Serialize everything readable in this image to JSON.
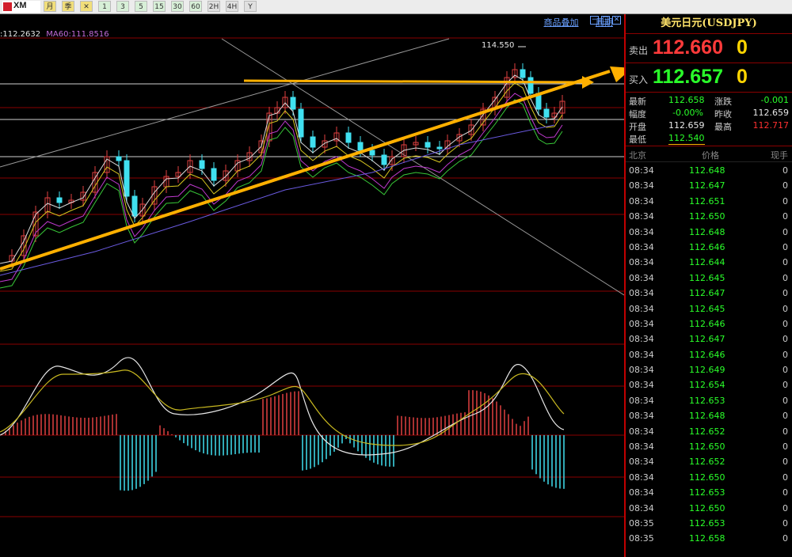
{
  "toolbar": {
    "logo_text": "XM",
    "buttons": [
      "月",
      "季",
      "✕",
      "1",
      "3",
      "5",
      "15",
      "30",
      "60",
      "2H",
      "4H",
      "Y"
    ]
  },
  "chart": {
    "ma_legend": [
      ":112.2632",
      "MA60:111.8516"
    ],
    "links": [
      "商品叠加",
      "周期"
    ],
    "window_buttons": [
      "−",
      "□",
      "✕"
    ],
    "peak_label": "114.550",
    "colors": {
      "bull": "#e04040",
      "bear": "#40e0f0",
      "grid": "#8a0000",
      "trend": "#ffb000"
    }
  },
  "side": {
    "title": "美元日元(USDJPY)",
    "sell_label": "卖出",
    "sell_value": "112.660",
    "sell_volume": "0",
    "buy_label": "买入",
    "buy_value": "112.657",
    "buy_volume": "0",
    "stats": [
      {
        "l1": "最新",
        "v1": "112.658",
        "c1": "#2aff2a",
        "l2": "涨跌",
        "v2": "-0.001",
        "c2": "#2aff2a"
      },
      {
        "l1": "幅度",
        "v1": "-0.00%",
        "c1": "#2aff2a",
        "l2": "昨收",
        "v2": "112.659",
        "c2": "#e6e6e6"
      },
      {
        "l1": "开盘",
        "v1": "112.659",
        "c1": "#e6e6e6",
        "l2": "最高",
        "v2": "112.717",
        "c2": "#ff3030"
      },
      {
        "l1": "最低",
        "v1": "112.540",
        "c1": "#2aff2a",
        "l2": "",
        "v2": "",
        "c2": "#e6e6e6"
      }
    ],
    "tick_header": {
      "time": "北京",
      "price": "价格",
      "vol": "现手"
    },
    "ticks": [
      {
        "time": "08:34",
        "price": "112.648",
        "vol": "0"
      },
      {
        "time": "08:34",
        "price": "112.647",
        "vol": "0"
      },
      {
        "time": "08:34",
        "price": "112.651",
        "vol": "0"
      },
      {
        "time": "08:34",
        "price": "112.650",
        "vol": "0"
      },
      {
        "time": "08:34",
        "price": "112.648",
        "vol": "0"
      },
      {
        "time": "08:34",
        "price": "112.646",
        "vol": "0"
      },
      {
        "time": "08:34",
        "price": "112.644",
        "vol": "0"
      },
      {
        "time": "08:34",
        "price": "112.645",
        "vol": "0"
      },
      {
        "time": "08:34",
        "price": "112.647",
        "vol": "0"
      },
      {
        "time": "08:34",
        "price": "112.645",
        "vol": "0"
      },
      {
        "time": "08:34",
        "price": "112.646",
        "vol": "0"
      },
      {
        "time": "08:34",
        "price": "112.647",
        "vol": "0"
      },
      {
        "time": "08:34",
        "price": "112.646",
        "vol": "0"
      },
      {
        "time": "08:34",
        "price": "112.649",
        "vol": "0"
      },
      {
        "time": "08:34",
        "price": "112.654",
        "vol": "0"
      },
      {
        "time": "08:34",
        "price": "112.653",
        "vol": "0"
      },
      {
        "time": "08:34",
        "price": "112.648",
        "vol": "0"
      },
      {
        "time": "08:34",
        "price": "112.652",
        "vol": "0"
      },
      {
        "time": "08:34",
        "price": "112.650",
        "vol": "0"
      },
      {
        "time": "08:34",
        "price": "112.652",
        "vol": "0"
      },
      {
        "time": "08:34",
        "price": "112.650",
        "vol": "0"
      },
      {
        "time": "08:34",
        "price": "112.653",
        "vol": "0"
      },
      {
        "time": "08:34",
        "price": "112.650",
        "vol": "0"
      },
      {
        "time": "08:35",
        "price": "112.653",
        "vol": "0"
      },
      {
        "time": "08:35",
        "price": "112.658",
        "vol": "0"
      }
    ]
  }
}
